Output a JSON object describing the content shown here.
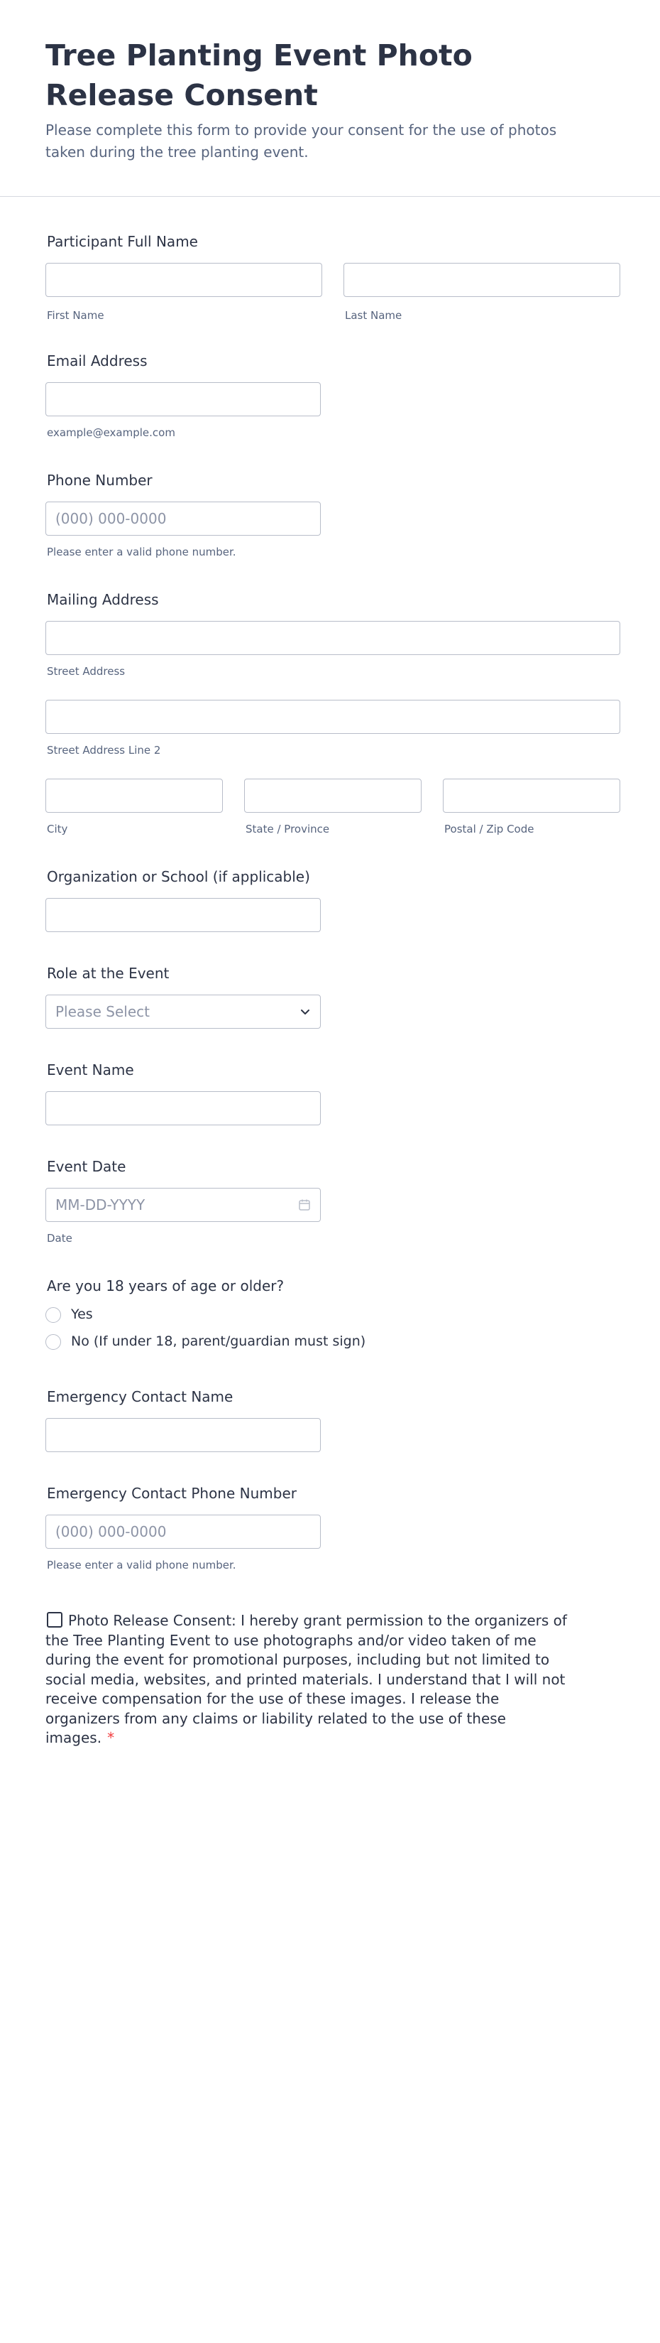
{
  "header": {
    "title": "Tree Planting Event Photo Release Consent",
    "subtitle": "Please complete this form to provide your consent for the use of photos taken during the tree planting event."
  },
  "fields": {
    "full_name": {
      "label": "Participant Full Name",
      "first_sub": "First Name",
      "last_sub": "Last Name"
    },
    "email": {
      "label": "Email Address",
      "sub": "example@example.com"
    },
    "phone": {
      "label": "Phone Number",
      "placeholder": "(000) 000-0000",
      "sub": "Please enter a valid phone number."
    },
    "address": {
      "label": "Mailing Address",
      "street_sub": "Street Address",
      "street2_sub": "Street Address Line 2",
      "city_sub": "City",
      "state_sub": "State / Province",
      "zip_sub": "Postal / Zip Code"
    },
    "organization": {
      "label": "Organization or School (if applicable)"
    },
    "role": {
      "label": "Role at the Event",
      "placeholder": "Please Select",
      "icon": "chevron-down-icon"
    },
    "event_name": {
      "label": "Event Name"
    },
    "event_date": {
      "label": "Event Date",
      "placeholder": "MM-DD-YYYY",
      "sub": "Date",
      "icon": "calendar-icon"
    },
    "age": {
      "label": "Are you 18 years of age or older?",
      "options": [
        "Yes",
        "No (If under 18, parent/guardian must sign)"
      ]
    },
    "emergency_name": {
      "label": "Emergency Contact Name"
    },
    "emergency_phone": {
      "label": "Emergency Contact Phone Number",
      "placeholder": "(000) 000-0000",
      "sub": "Please enter a valid phone number."
    }
  },
  "consent": {
    "text": "Photo Release Consent: I hereby grant permission to the organizers of the Tree Planting Event to use photographs and/or video taken of me during the event for promotional purposes, including but not limited to social media, websites, and printed materials. I understand that I will not receive compensation for the use of these images. I release the organizers from any claims or liability related to the use of these images.",
    "required_mark": "*"
  },
  "colors": {
    "text": "#2c3345",
    "muted": "#57647e",
    "border": "#b8bdc9",
    "required": "#f23a3c"
  }
}
